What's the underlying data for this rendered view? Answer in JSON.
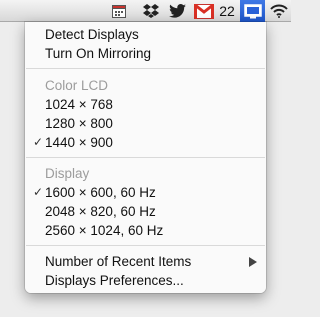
{
  "menubar": {
    "icons": [
      {
        "name": "calendar-icon"
      },
      {
        "name": "dropbox-icon"
      },
      {
        "name": "twitter-icon"
      },
      {
        "name": "gmail-icon"
      },
      {
        "name": "display-menu-icon"
      },
      {
        "name": "wifi-icon"
      }
    ],
    "gmail_count": "22"
  },
  "menu": {
    "actions": {
      "detect": "Detect Displays",
      "mirroring": "Turn On Mirroring"
    },
    "color_lcd": {
      "header": "Color LCD",
      "resolutions": [
        "1024 × 768",
        "1280 × 800",
        "1440 × 900"
      ],
      "selected_index": 2
    },
    "display": {
      "header": "Display",
      "resolutions": [
        "1600 × 600, 60 Hz",
        "2048 × 820, 60 Hz",
        "2560 × 1024, 60 Hz"
      ],
      "selected_index": 0
    },
    "recent_items": "Number of Recent Items",
    "preferences": "Displays Preferences...",
    "check_mark": "✓"
  }
}
